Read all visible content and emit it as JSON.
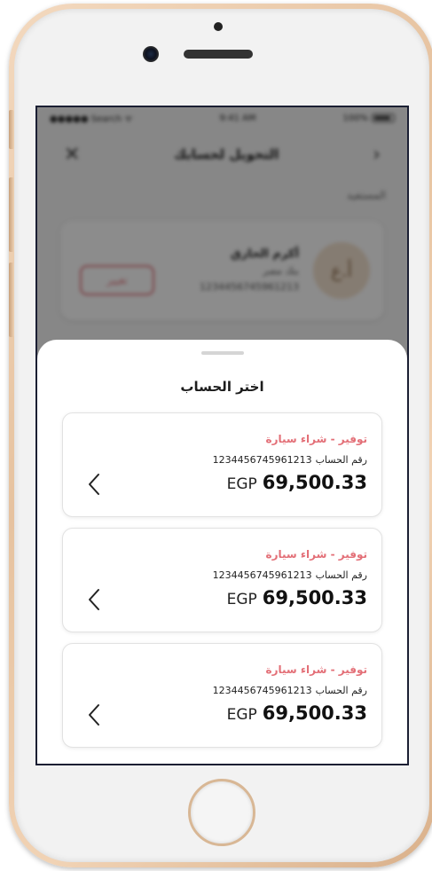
{
  "background": {
    "status": {
      "carrier": "●●●●● Search ᯤ",
      "time": "9:41 AM",
      "battery": "100%"
    },
    "header": {
      "title": "التحويل لحسابك"
    },
    "section_label": "المستفيد",
    "card": {
      "avatar_initials": "أ.ع",
      "name": "أكرم الحازق",
      "sub1": "بنك مصر",
      "sub2": "1234456745961213",
      "change_label": "تغيير"
    }
  },
  "sheet": {
    "title": "اختر الحساب",
    "accounts": [
      {
        "name": "توفير - شراء سيارة",
        "number_label": "رقم الحساب",
        "number": "1234456745961213",
        "currency": "EGP",
        "amount": "69,500.33"
      },
      {
        "name": "توفير - شراء سيارة",
        "number_label": "رقم الحساب",
        "number": "1234456745961213",
        "currency": "EGP",
        "amount": "69,500.33"
      },
      {
        "name": "توفير - شراء سيارة",
        "number_label": "رقم الحساب",
        "number": "1234456745961213",
        "currency": "EGP",
        "amount": "69,500.33"
      }
    ]
  },
  "colors": {
    "accent": "#e36f77",
    "phone_frame": "#e6c29f"
  },
  "icons": {
    "arrow": "chevron-left-icon",
    "close": "close-icon",
    "back": "chevron-right-icon"
  }
}
